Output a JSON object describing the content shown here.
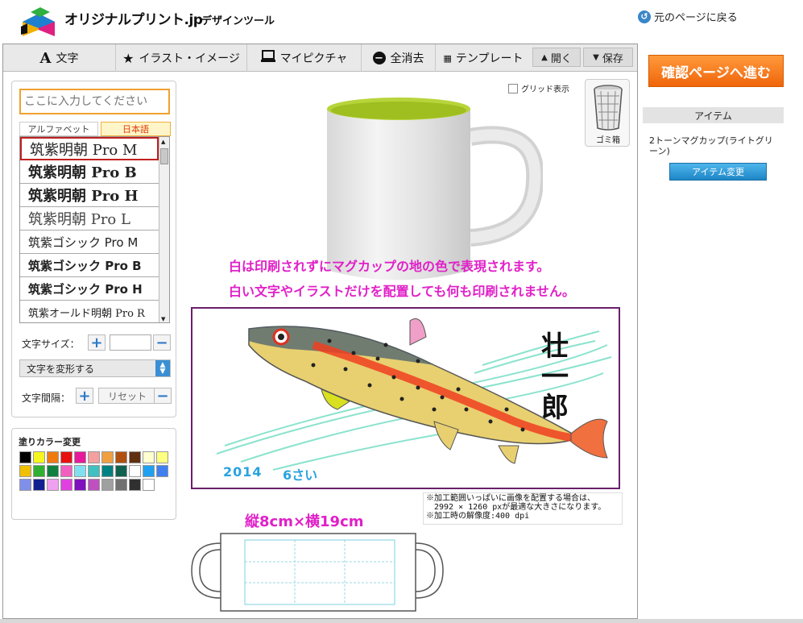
{
  "header": {
    "logo_text": "オリジナルプリント.jp",
    "logo_sub": "デザインツール",
    "back_link": "元のページに戻る"
  },
  "toolbar": {
    "text_tab": "文字",
    "illust_tab": "イラスト・イメージ",
    "mypicture_tab": "マイピクチャ",
    "clear_all": "全消去",
    "template": "テンプレート",
    "open": "開く",
    "save": "保存"
  },
  "text_panel": {
    "input_placeholder": "ここに入力してください",
    "tab_alphabet": "アルファベット",
    "tab_japanese": "日本語",
    "fonts": [
      "筑紫明朝 Pro M",
      "筑紫明朝 Pro B",
      "筑紫明朝 Pro H",
      "筑紫明朝 Pro L",
      "筑紫ゴシック Pro M",
      "筑紫ゴシック Pro B",
      "筑紫ゴシック Pro H",
      "筑紫オールド明朝 Pro R"
    ],
    "size_label": "文字サイズ：",
    "transform_label": "文字を変形する",
    "spacing_label": "文字間隔：",
    "reset_label": "リセット",
    "plus": "+",
    "minus": "−"
  },
  "color_panel": {
    "title": "塗りカラー変更",
    "colors": [
      "#000000",
      "#f5f520",
      "#f07a10",
      "#e81010",
      "#e8189a",
      "#f5a0a0",
      "#f0a040",
      "#b05010",
      "#603010",
      "#ffffd0",
      "#ffff80",
      "#f0c000",
      "#30b030",
      "#108040",
      "#f060c0",
      "#80e0f0",
      "#40c0c0",
      "#008080",
      "#106050",
      "#ffffff",
      "#20a0f0",
      "#4080f0",
      "#8090e8",
      "#102090",
      "#f0a0f0",
      "#e040e0",
      "#8010c0",
      "#c050c0",
      "#a0a0a0",
      "#707070",
      "#303030",
      "#ffffff"
    ]
  },
  "canvas": {
    "grid_label": "グリッド表示",
    "trash_label": "ゴミ箱",
    "notice_line1": "白は印刷されずにマグカップの地の色で表現されます。",
    "notice_line2": "白い文字やイラストだけを配置しても何も印刷されません。",
    "artwork": {
      "year": "2014",
      "age": "6さい",
      "name": "壮一郎"
    },
    "print_note_1": "※加工範囲いっぱいに画像を配置する場合は、",
    "print_note_2": "2992 × 1260 pxが最適な大きさになります。",
    "print_note_3": "※加工時の解像度:400 dpi",
    "size_caption": "縦8cm×横19cm"
  },
  "sidebar": {
    "confirm_button": "確認ページへ進む",
    "item_header": "アイテム",
    "item_name": "2トーンマグカップ(ライトグリーン)",
    "change_item_button": "アイテム変更"
  }
}
